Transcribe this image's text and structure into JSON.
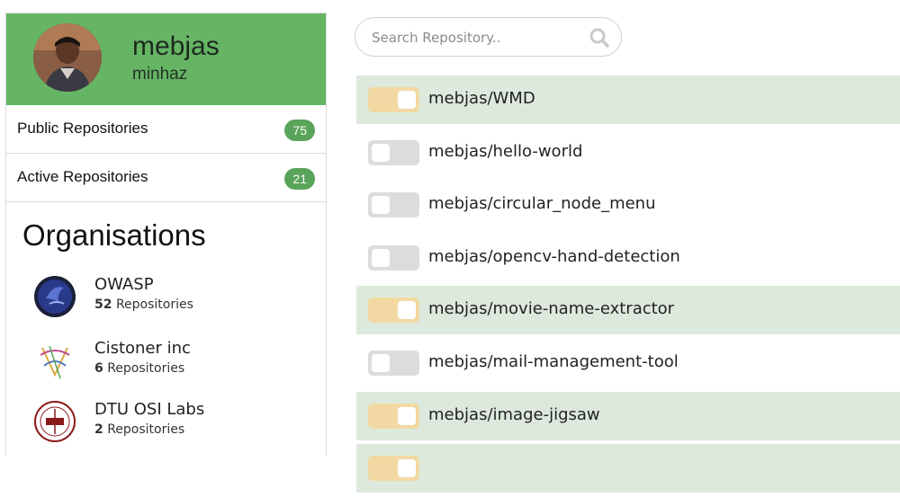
{
  "profile": {
    "name": "mebjas",
    "username": "minhaz"
  },
  "stats": [
    {
      "label": "Public Repositories",
      "count": "75"
    },
    {
      "label": "Active Repositories",
      "count": "21"
    }
  ],
  "organisations": {
    "heading": "Organisations",
    "items": [
      {
        "name": "OWASP",
        "count": "52",
        "suffix": "Repositories",
        "icon": "owasp-logo"
      },
      {
        "name": "Cistoner inc",
        "count": "6",
        "suffix": "Repositories",
        "icon": "cistoner-logo"
      },
      {
        "name": "DTU OSI Labs",
        "count": "2",
        "suffix": "Repositories",
        "icon": "dtu-logo"
      }
    ]
  },
  "search": {
    "placeholder": "Search Repository.."
  },
  "repos": [
    {
      "name": "mebjas/WMD",
      "active": true
    },
    {
      "name": "mebjas/hello-world",
      "active": false
    },
    {
      "name": "mebjas/circular_node_menu",
      "active": false
    },
    {
      "name": "mebjas/opencv-hand-detection",
      "active": false
    },
    {
      "name": "mebjas/movie-name-extractor",
      "active": true
    },
    {
      "name": "mebjas/mail-management-tool",
      "active": false
    },
    {
      "name": "mebjas/image-jigsaw",
      "active": true
    },
    {
      "name": "",
      "active": true
    }
  ],
  "colors": {
    "header_green": "#65b565",
    "badge_green": "#5aa35a",
    "active_row": "#dde9dc",
    "toggle_on": "#f2d9a3",
    "toggle_off": "#dcdcdc"
  }
}
